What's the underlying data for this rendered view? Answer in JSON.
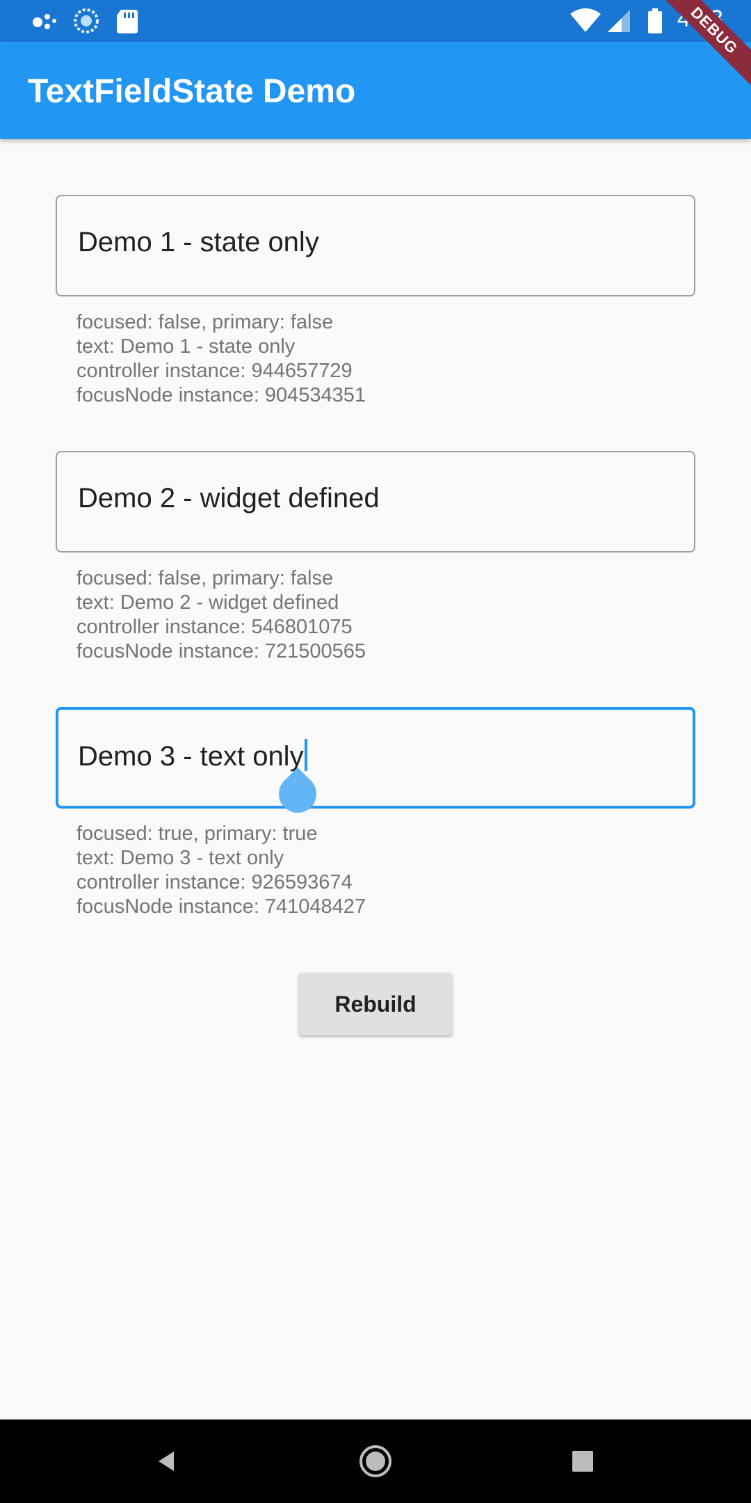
{
  "status_bar": {
    "time": "4:33",
    "icons": [
      "assistant-dots-icon",
      "sync-icon",
      "sd-card-icon",
      "wifi-icon",
      "cell-signal-icon",
      "battery-icon"
    ]
  },
  "app_bar": {
    "title": "TextFieldState Demo"
  },
  "debug_banner": "DEBUG",
  "demos": [
    {
      "value": "Demo 1 - state only",
      "focused": false,
      "info": {
        "status": "focused: false, primary: false",
        "text": "text: Demo 1 - state only",
        "controller": "controller instance: 944657729",
        "focus_node": "focusNode instance: 904534351"
      }
    },
    {
      "value": "Demo 2 - widget defined",
      "focused": false,
      "info": {
        "status": "focused: false, primary: false",
        "text": "text: Demo 2 - widget defined",
        "controller": "controller instance: 546801075",
        "focus_node": "focusNode instance: 721500565"
      }
    },
    {
      "value": "Demo 3 - text only",
      "focused": true,
      "info": {
        "status": "focused: true, primary: true",
        "text": "text: Demo 3 - text only",
        "controller": "controller instance: 926593674",
        "focus_node": "focusNode instance: 741048427"
      }
    }
  ],
  "rebuild_button": "Rebuild",
  "nav_bar": {
    "buttons": [
      "back-icon",
      "home-icon",
      "recents-icon"
    ]
  },
  "colors": {
    "primary": "#2196f3",
    "status_bar": "#1976d2",
    "debug": "#8b2c3e"
  }
}
